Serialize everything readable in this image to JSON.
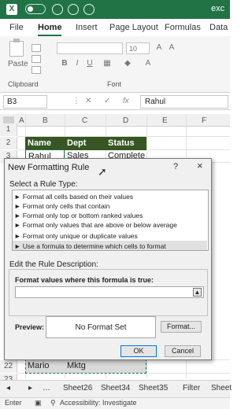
{
  "window": {
    "title": "exc"
  },
  "tabs": [
    "File",
    "Home",
    "Insert",
    "Page Layout",
    "Formulas",
    "Data"
  ],
  "ribbon": {
    "paste_label": "Paste",
    "font_size": "10",
    "groups": [
      "Clipboard",
      "Font"
    ]
  },
  "formula_bar": {
    "name_box": "B3",
    "fx": "fx",
    "content": "Rahul"
  },
  "columns": [
    "A",
    "B",
    "C",
    "D",
    "E",
    "F"
  ],
  "rows": [
    {
      "n": "1"
    },
    {
      "n": "2"
    },
    {
      "n": "3"
    },
    {
      "n": "22"
    },
    {
      "n": "23"
    }
  ],
  "sheet": {
    "header": [
      "Name",
      "Dept",
      "Status"
    ],
    "row3": [
      "Rahul",
      "Sales",
      "Complete"
    ],
    "row22": [
      "Mario",
      "Mktg",
      ""
    ]
  },
  "dialog": {
    "title": "New Formatting Rule",
    "help": "?",
    "close": "×",
    "select_rule_type": "Select a Rule Type:",
    "rules": [
      "► Format all cells based on their values",
      "► Format only cells that contain",
      "► Format only top or bottom ranked values",
      "► Format only values that are above or below average",
      "► Format only unique or duplicate values",
      "► Use a formula to determine which cells to format"
    ],
    "edit_desc": "Edit the Rule Description:",
    "formula_label": "Format values where this formula is true:",
    "formula_value": "",
    "preview_label": "Preview:",
    "preview_text": "No Format Set",
    "format_button": "Format...",
    "ok": "OK",
    "cancel": "Cancel"
  },
  "sheets": [
    "Sheet26",
    "Sheet34",
    "Sheet35",
    "Filter",
    "Sheet"
  ],
  "status": {
    "mode": "Enter",
    "accessibility": "Accessibility: Investigate"
  }
}
